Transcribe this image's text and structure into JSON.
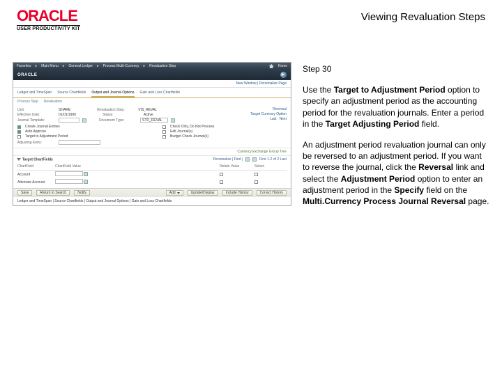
{
  "header": {
    "brand": "ORACLE",
    "brand_sub": "USER PRODUCTIVITY KIT",
    "doc_title": "Viewing Revaluation Steps"
  },
  "instructions": {
    "step_label": "Step 30",
    "para1_a": "Use the ",
    "para1_b": "Target to Adjustment Period",
    "para1_c": " option to specify an adjustment period as the accounting period for the revaluation journals. Enter a period in the ",
    "para1_d": "Target Adjusting Period",
    "para1_e": " field.",
    "para2_a": "An adjustment period revaluation journal can only be reversed to an adjustment period. If you want to reverse the journal, click the ",
    "para2_b": "Reversal",
    "para2_c": " link and select the ",
    "para2_d": "Adjustment Period",
    "para2_e": " option to enter an adjustment period in the ",
    "para2_f": "Specify",
    "para2_g": " field on the ",
    "para2_h": "Multi.Currency Process Journal Reversal",
    "para2_i": " page."
  },
  "app": {
    "topbar": {
      "i1": "Favorites",
      "i2": "Main Menu",
      "i3": "General Ledger",
      "i4": "Process Multi-Currency",
      "i5": "Revaluation Step",
      "home": "Home"
    },
    "brandbar": {
      "logo": "ORACLE"
    },
    "sublinks": "New Window | Personalize Page",
    "navtabs": {
      "t1": "Ledger and TimeSpan",
      "t2": "Source Chartfields",
      "t3": "Output and Journal Options",
      "t4": "Gain and Loss Chartfields",
      "active": "Output and Journal Options"
    },
    "subnav": {
      "s1": "Process Step",
      "s2": "Revaluation"
    },
    "form": {
      "unit_lbl": "Unit:",
      "unit_val": "SHARE",
      "step_lbl": "Revaluation Step:",
      "step_val": "VIS_REVAL",
      "eff_lbl": "Effective Date:",
      "eff_val": "01/01/1900",
      "status_lbl": "Status:",
      "status_val": "Active",
      "jtmpl_lbl": "Journal Template:",
      "jtmpl_val": "",
      "dtype_lbl": "Document Type:",
      "dtype_val": "STD_REVAL",
      "rightlink1": "Reversal",
      "rightlink2": "Target Currency Option",
      "rightlink_last_a": "Last",
      "rightlink_last_b": "Next",
      "cb1": "Create Journal Entries",
      "cb2": "Check Only, Do Not Process",
      "cb3": "Auto Approve",
      "cb4": "Edit Journal(s)",
      "cb5": "Target to Adjustment Period",
      "cb6": "Budget Check Journal(s)",
      "adj_lbl": "Adjusting Entry:"
    },
    "footnote": "Currency Exchange Group Tree",
    "section": {
      "title": "Target ChartFields",
      "tools": "Personalize | Find |",
      "range": "First  1-2 of 2  Last"
    },
    "table": {
      "h1": "ChartField",
      "h2": "ChartField Value",
      "h3": "Retain Value",
      "h4": "Select",
      "r1c1": "Account",
      "r1c2": "",
      "r2c1": "Alternate Account",
      "r2c2": ""
    },
    "bottombar": {
      "b1": "Save",
      "b2": "Return to Search",
      "b3": "Notify",
      "b4": "Add",
      "b5": "Update/Display",
      "b6": "Include History",
      "b7": "Correct History"
    },
    "bottomtext": "Ledger and TimeSpan | Source Chartfields | Output and Journal Options | Gain and Loss Chartfields"
  }
}
